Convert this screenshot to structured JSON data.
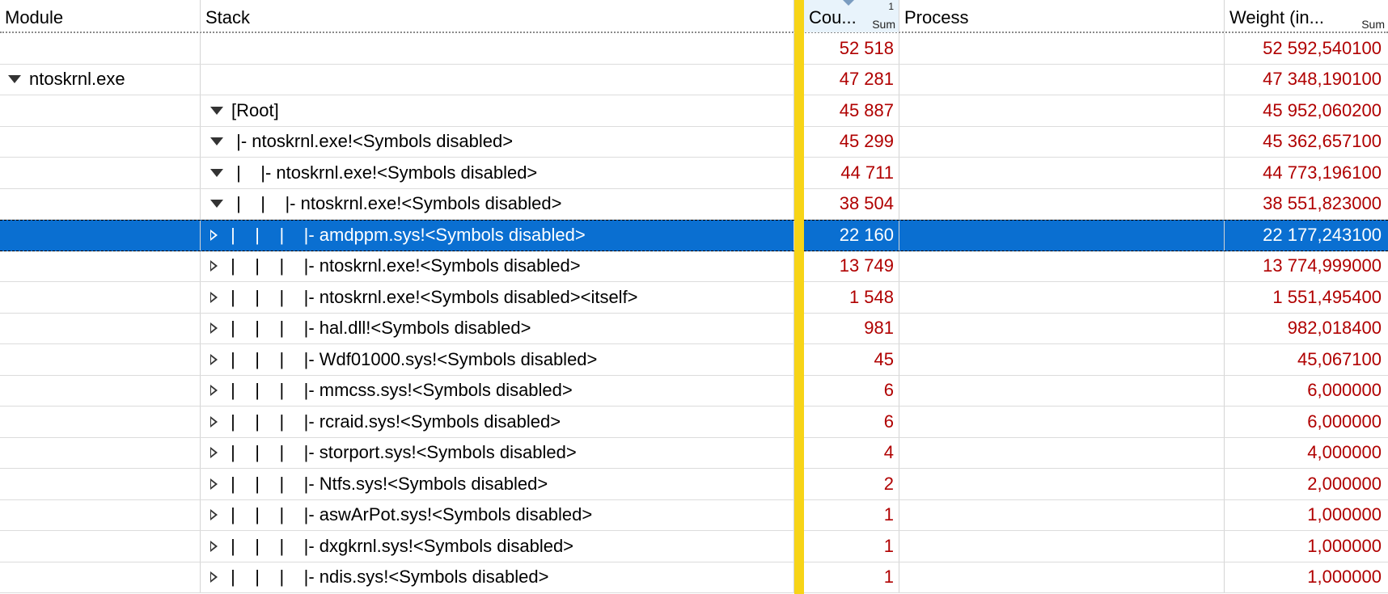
{
  "columns": {
    "module": "Module",
    "stack": "Stack",
    "count": "Cou...",
    "count_sort_index": "1",
    "count_sum": "Sum",
    "process": "Process",
    "weight": "Weight (in...",
    "weight_sum": "Sum"
  },
  "rows": [
    {
      "module": "",
      "expander": "",
      "stack": "",
      "count": "52 518",
      "process": "",
      "weight": "52 592,540100"
    },
    {
      "module": "ntoskrnl.exe",
      "module_expander": "expanded",
      "expander": "",
      "stack": "",
      "count": "47 281",
      "process": "",
      "weight": "47 348,190100"
    },
    {
      "module": "",
      "expander": "expanded",
      "stack": "[Root]",
      "count": "45 887",
      "process": "",
      "weight": "45 952,060200"
    },
    {
      "module": "",
      "expander": "expanded",
      "stack": " |- ntoskrnl.exe!<Symbols disabled>",
      "count": "45 299",
      "process": "",
      "weight": "45 362,657100"
    },
    {
      "module": "",
      "expander": "expanded",
      "stack": " |    |- ntoskrnl.exe!<Symbols disabled>",
      "count": "44 711",
      "process": "",
      "weight": "44 773,196100"
    },
    {
      "module": "",
      "expander": "expanded",
      "stack": " |    |    |- ntoskrnl.exe!<Symbols disabled>",
      "count": "38 504",
      "process": "",
      "weight": "38 551,823000"
    },
    {
      "module": "",
      "expander": "collapsed",
      "stack": " |    |    |    |- amdppm.sys!<Symbols disabled>",
      "count": "22 160",
      "process": "",
      "weight": "22 177,243100",
      "selected": true
    },
    {
      "module": "",
      "expander": "collapsed",
      "stack": " |    |    |    |- ntoskrnl.exe!<Symbols disabled>",
      "count": "13 749",
      "process": "",
      "weight": "13 774,999000"
    },
    {
      "module": "",
      "expander": "collapsed",
      "stack": " |    |    |    |- ntoskrnl.exe!<Symbols disabled><itself>",
      "count": "1 548",
      "process": "",
      "weight": "1 551,495400"
    },
    {
      "module": "",
      "expander": "collapsed",
      "stack": " |    |    |    |- hal.dll!<Symbols disabled>",
      "count": "981",
      "process": "",
      "weight": "982,018400"
    },
    {
      "module": "",
      "expander": "collapsed",
      "stack": " |    |    |    |- Wdf01000.sys!<Symbols disabled>",
      "count": "45",
      "process": "",
      "weight": "45,067100"
    },
    {
      "module": "",
      "expander": "collapsed",
      "stack": " |    |    |    |- mmcss.sys!<Symbols disabled>",
      "count": "6",
      "process": "",
      "weight": "6,000000"
    },
    {
      "module": "",
      "expander": "collapsed",
      "stack": " |    |    |    |- rcraid.sys!<Symbols disabled>",
      "count": "6",
      "process": "",
      "weight": "6,000000"
    },
    {
      "module": "",
      "expander": "collapsed",
      "stack": " |    |    |    |- storport.sys!<Symbols disabled>",
      "count": "4",
      "process": "",
      "weight": "4,000000"
    },
    {
      "module": "",
      "expander": "collapsed",
      "stack": " |    |    |    |- Ntfs.sys!<Symbols disabled>",
      "count": "2",
      "process": "",
      "weight": "2,000000"
    },
    {
      "module": "",
      "expander": "collapsed",
      "stack": " |    |    |    |- aswArPot.sys!<Symbols disabled>",
      "count": "1",
      "process": "",
      "weight": "1,000000"
    },
    {
      "module": "",
      "expander": "collapsed",
      "stack": " |    |    |    |- dxgkrnl.sys!<Symbols disabled>",
      "count": "1",
      "process": "",
      "weight": "1,000000"
    },
    {
      "module": "",
      "expander": "collapsed",
      "stack": " |    |    |    |- ndis.sys!<Symbols disabled>",
      "count": "1",
      "process": "",
      "weight": "1,000000"
    }
  ],
  "colors": {
    "selection": "#0a6fd1",
    "value_text": "#b00000",
    "divider": "#f7d417"
  }
}
